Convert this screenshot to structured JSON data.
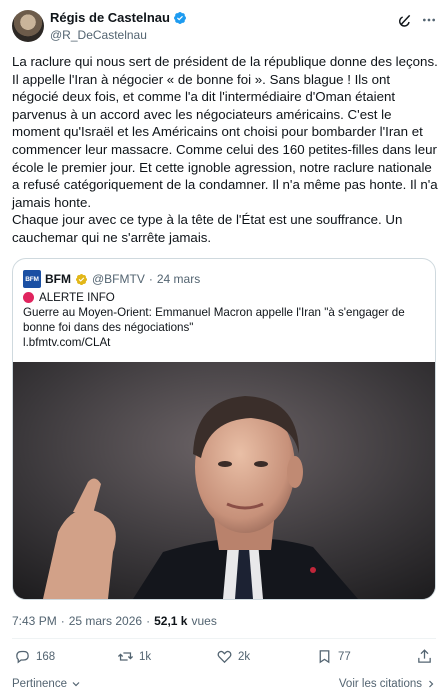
{
  "author": {
    "display_name": "Régis de Castelnau",
    "handle": "@R_DeCastelnau",
    "verified_color": "#1d9bf0"
  },
  "tweet": {
    "paragraphs": [
      "La raclure qui nous sert de président de la république donne des leçons. Il appelle l'Iran à négocier « de bonne foi ». Sans blague ! Ils ont négocié deux fois, et comme l'a dit l'intermédiaire d'Oman étaient parvenus à un accord avec les négociateurs américains. C'est le moment qu'Israël et les Américains ont choisi pour bombarder l'Iran et commencer leur massacre. Comme celui des 160 petites-filles dans leur école le premier jour. Et cette ignoble agression, notre raclure nationale a refusé catégoriquement de la condamner. Il n'a même pas honte. Il n'a jamais honte.",
      "Chaque jour avec ce type à la tête de l'État est une souffrance. Un cauchemar qui ne s'arrête jamais."
    ]
  },
  "quote": {
    "logo_text": "BFM",
    "name": "BFM",
    "handle": "@BFMTV",
    "separator": "·",
    "date": "24 mars",
    "alert": "ALERTE INFO",
    "text": "Guerre au Moyen-Orient: Emmanuel Macron appelle l'Iran \"à s'engager de bonne foi dans des négociations\"",
    "link": "l.bfmtv.com/CLAt",
    "gold_check_color": "#e2b719",
    "alert_dot_color": "#e0245e"
  },
  "meta": {
    "time": "7:43 PM",
    "separator": "·",
    "date": "25 mars 2026",
    "views_count": "52,1 k",
    "views_label": "vues"
  },
  "actions": {
    "replies": "168",
    "reposts": "1k",
    "likes": "2k",
    "bookmarks": "77"
  },
  "footer": {
    "relevance": "Pertinence",
    "quotes": "Voir les citations"
  },
  "icons": [
    "grok-icon",
    "more-icon",
    "verified-icon",
    "reply-icon",
    "repost-icon",
    "like-icon",
    "bookmark-icon",
    "chevron-down-icon",
    "chevron-right-icon"
  ]
}
